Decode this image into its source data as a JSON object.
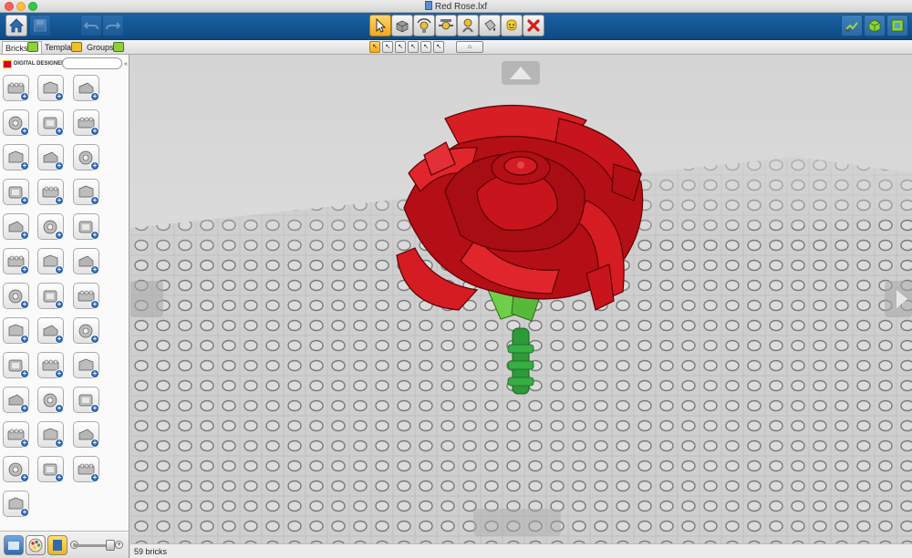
{
  "window": {
    "title": "Red Rose.lxf"
  },
  "toolbar": {
    "left": [
      {
        "name": "home-button",
        "icon": "home-icon",
        "style": "light"
      },
      {
        "name": "save-button",
        "icon": "save-icon",
        "style": "dark",
        "disabled": true
      },
      {
        "name": "undo-button",
        "icon": "undo-icon",
        "style": "dark",
        "disabled": true
      },
      {
        "name": "redo-button",
        "icon": "redo-icon",
        "style": "dark",
        "disabled": true
      }
    ],
    "center": [
      {
        "name": "select-tool-button",
        "icon": "cursor-icon",
        "active": true
      },
      {
        "name": "clone-tool-button",
        "icon": "clone-brick-icon"
      },
      {
        "name": "hinge-tool-button",
        "icon": "hinge-icon"
      },
      {
        "name": "hinge-align-tool-button",
        "icon": "hinge-align-icon"
      },
      {
        "name": "flex-tool-button",
        "icon": "flex-icon"
      },
      {
        "name": "paint-tool-button",
        "icon": "paint-bucket-icon"
      },
      {
        "name": "decoration-tool-button",
        "icon": "minifig-head-icon"
      },
      {
        "name": "delete-tool-button",
        "icon": "delete-x-icon"
      }
    ],
    "right": [
      {
        "name": "build-mode-button",
        "icon": "build-mode-icon"
      },
      {
        "name": "view-mode-button",
        "icon": "view-mode-icon"
      },
      {
        "name": "building-guide-button",
        "icon": "building-guide-icon"
      }
    ]
  },
  "tabs": [
    {
      "label": "Bricks",
      "active": true
    },
    {
      "label": "Templates",
      "active": false
    },
    {
      "label": "Groups",
      "active": false
    }
  ],
  "select_modes": [
    "single",
    "connected",
    "color",
    "shape",
    "color-shape"
  ],
  "sidebar": {
    "brand": "DIGITAL DESIGNER",
    "search_placeholder": "",
    "bricks": [
      "brick-2x4",
      "brick-corner",
      "brick-1x1-slope",
      "plate-2x4",
      "plate-wedge",
      "slope-long",
      "round-brick",
      "brick-2x2",
      "plate-holes",
      "technic-brick",
      "technic-brick-small",
      "door-panel",
      "gear",
      "technic-axle-connector",
      "technic-beam",
      "technic-liftarm",
      "technic-pin",
      "technic-wheel",
      "pipe-segment",
      "cylinder",
      "tile-flat",
      "wrench-tool",
      "hose-segment",
      "bracket-frame",
      "chain-link",
      "propeller",
      "zigzag-piece",
      "wheel-hub",
      "minifigure",
      "round-cone",
      "helmet",
      "dome-cap",
      "skeleton-part",
      "minifig-torso",
      "hook-clip",
      "sword-hilt",
      "animal-figure"
    ]
  },
  "status": {
    "brick_count": "59 bricks"
  },
  "colors": {
    "toolbar_blue": "#1b62a4",
    "rose_red": "#c8141c",
    "stem_green": "#2f9a3a",
    "baseplate_gray": "#cfcfcf",
    "accent_yellow": "#f0a91f"
  }
}
